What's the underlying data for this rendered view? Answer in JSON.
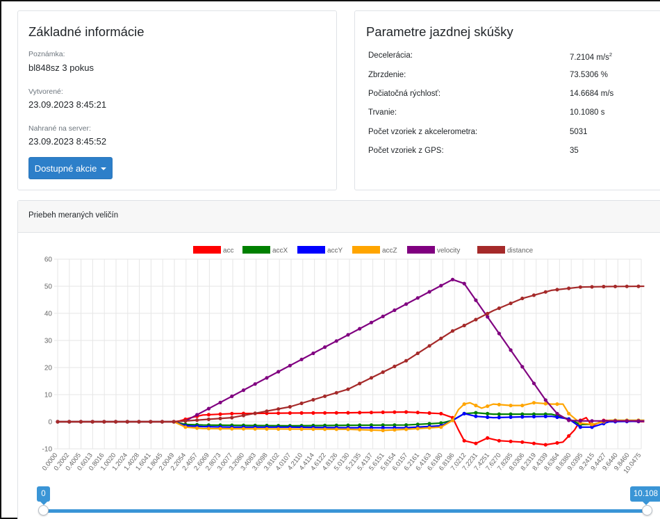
{
  "basic_info": {
    "title": "Základné informácie",
    "note_label": "Poznámka:",
    "note_value": "bl848sz 3 pokus",
    "created_label": "Vytvorené:",
    "created_value": "23.09.2023 8:45:21",
    "uploaded_label": "Nahrané na server:",
    "uploaded_value": "23.09.2023 8:45:52",
    "actions_button": "Dostupné akcie"
  },
  "test_params": {
    "title": "Parametre jazdnej skúšky",
    "rows": [
      {
        "label": "Decelerácia:",
        "value": "7.2104 m/s",
        "sup": "2"
      },
      {
        "label": "Zbrzdenie:",
        "value": "73.5306 %"
      },
      {
        "label": "Počiatočná rýchlosť:",
        "value": "14.6684 m/s"
      },
      {
        "label": "Trvanie:",
        "value": "10.1080 s"
      },
      {
        "label": "Počet vzoriek z akcelerometra:",
        "value": "5031"
      },
      {
        "label": "Počet vzoriek z GPS:",
        "value": "35"
      }
    ]
  },
  "chart_section": {
    "header": "Priebeh meraných veličín"
  },
  "slider": {
    "min_label": "0",
    "max_label": "10.108",
    "min_value": 0,
    "max_value": 10.108
  },
  "colors": {
    "primary": "#2d7fc9",
    "acc": "#ff0000",
    "accX": "#008000",
    "accY": "#0000ff",
    "accZ": "#ffa500",
    "velocity": "#800080",
    "distance": "#a52a2a"
  },
  "chart_data": {
    "type": "line",
    "ylim": [
      -10,
      60
    ],
    "y_ticks": [
      -10,
      0,
      10,
      20,
      30,
      40,
      50,
      60
    ],
    "x_tick_labels": [
      "0.0000",
      "0.2002",
      "0.4005",
      "0.6013",
      "0.8016",
      "1.0020",
      "1.2024",
      "1.4028",
      "1.6041",
      "1.8045",
      "2.0049",
      "2.2054",
      "2.4057",
      "2.6069",
      "2.8073",
      "3.0077",
      "3.2080",
      "3.4083",
      "3.6098",
      "3.8102",
      "4.0107",
      "4.2110",
      "4.4114",
      "4.6122",
      "4.8126",
      "5.0130",
      "5.2135",
      "5.4137",
      "5.6151",
      "5.8154",
      "6.0157",
      "6.2161",
      "6.4163",
      "6.6180",
      "6.8196",
      "7.0212",
      "7.2231",
      "7.4251",
      "7.6270",
      "7.8285",
      "8.0306",
      "8.2319",
      "8.4339",
      "8.6364",
      "8.8380",
      "9.0395",
      "9.2415",
      "9.4427",
      "9.6440",
      "9.8460",
      "10.0475"
    ],
    "legend_position": "top",
    "grid": true,
    "series": [
      {
        "name": "acc",
        "color": "#ff0000",
        "x": [
          0,
          2.0,
          2.1,
          2.3,
          2.5,
          3.0,
          4.0,
          5.0,
          6.0,
          6.6,
          6.8,
          6.9,
          7.0,
          7.2,
          7.4,
          7.6,
          8.0,
          8.4,
          8.7,
          8.9,
          9.0,
          9.1,
          9.2,
          9.4,
          10.1
        ],
        "values": [
          0,
          0,
          0.3,
          1.5,
          2.5,
          3.0,
          3.2,
          3.3,
          3.6,
          3.0,
          1.5,
          -3,
          -7,
          -8,
          -6,
          -7,
          -7.5,
          -8.5,
          -7.5,
          -3,
          0.5,
          1.5,
          -1.5,
          0.5,
          0
        ]
      },
      {
        "name": "accX",
        "color": "#008000",
        "x": [
          0,
          2.0,
          2.2,
          2.5,
          3.0,
          4.0,
          5.0,
          6.0,
          6.6,
          6.8,
          7.0,
          7.2,
          7.5,
          8.0,
          8.5,
          8.8,
          9.0,
          9.2,
          9.5,
          10.1
        ],
        "values": [
          0,
          0,
          -1,
          -1.2,
          -1.3,
          -1.5,
          -1.3,
          -1.2,
          -0.5,
          0.5,
          3.0,
          3.3,
          2.8,
          2.8,
          2.8,
          1.0,
          -1.0,
          -1.0,
          0.5,
          0.5
        ]
      },
      {
        "name": "accY",
        "color": "#0000ff",
        "x": [
          0,
          2.0,
          2.2,
          2.5,
          3.0,
          4.0,
          5.0,
          6.0,
          6.6,
          6.8,
          7.0,
          7.2,
          7.5,
          8.0,
          8.5,
          8.8,
          9.0,
          9.2,
          9.5,
          10.1
        ],
        "values": [
          0,
          0,
          -1.5,
          -1.8,
          -2.0,
          -2.0,
          -2.2,
          -2.2,
          -1.5,
          0.5,
          3.0,
          2.0,
          1.5,
          1.8,
          2.0,
          1.0,
          -2.0,
          -2.0,
          0,
          0.2
        ]
      },
      {
        "name": "accZ",
        "color": "#ffa500",
        "x": [
          0,
          2.0,
          2.2,
          2.5,
          3.0,
          4.0,
          5.0,
          5.6,
          6.0,
          6.6,
          6.8,
          6.9,
          7.0,
          7.1,
          7.3,
          7.5,
          7.8,
          8.0,
          8.2,
          8.5,
          8.7,
          8.8,
          9.0,
          9.2,
          9.5,
          10.1
        ],
        "values": [
          0,
          0,
          -2.0,
          -2.5,
          -2.6,
          -2.7,
          -2.8,
          -3.2,
          -2.8,
          -2.0,
          0.5,
          4.5,
          6.5,
          7.0,
          5.0,
          6.5,
          6.0,
          6.0,
          7.0,
          6.5,
          6.5,
          3.0,
          -0.5,
          -1.0,
          0.5,
          0.5
        ]
      },
      {
        "name": "velocity",
        "color": "#800080",
        "x": [
          0,
          2.0,
          2.2,
          6.8,
          7.0,
          8.4,
          8.6,
          8.8,
          9.0,
          9.2,
          9.5,
          10.1
        ],
        "values": [
          0,
          0,
          0.3,
          52.5,
          51.0,
          8.0,
          3.0,
          0.5,
          0.3,
          0.3,
          0.3,
          0.3
        ]
      },
      {
        "name": "distance",
        "color": "#a52a2a",
        "x": [
          0,
          2.0,
          3.0,
          4.0,
          5.0,
          6.0,
          6.8,
          7.0,
          7.5,
          8.0,
          8.5,
          9.0,
          9.5,
          10.1
        ],
        "values": [
          0,
          0,
          1.5,
          5.5,
          12.0,
          22.5,
          33.5,
          35.5,
          41.0,
          45.5,
          48.5,
          49.7,
          49.9,
          50.0
        ]
      }
    ]
  }
}
